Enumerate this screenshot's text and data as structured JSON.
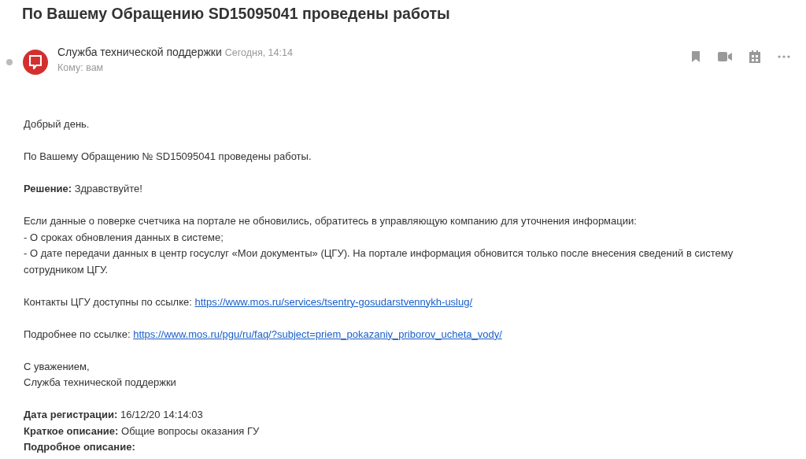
{
  "subject": "По Вашему Обращению SD15095041 проведены работы",
  "message": {
    "unread": true,
    "sender": "Служба технической поддержки",
    "date": "Сегодня, 14:14",
    "recipient": "Кому: вам"
  },
  "body": [
    {
      "lines": [
        {
          "text": "Добрый день."
        }
      ]
    },
    {
      "lines": [
        {
          "text": "По Вашему Обращению № SD15095041 проведены работы."
        }
      ]
    },
    {
      "lines": [
        {
          "text": "**Решение:** Здравствуйте!"
        }
      ]
    },
    {
      "lines": [
        {
          "text": "Если данные о поверке счетчика на портале не обновились, обратитесь в управляющую компанию для уточнения информации:"
        },
        {
          "text": "- О сроках обновления данных в системе;"
        },
        {
          "text": "- О дате передачи данных в центр госуслуг «Мои документы» (ЦГУ). На портале информация обновится только после внесения сведений в систему сотрудником ЦГУ."
        }
      ]
    },
    {
      "lines": [
        {
          "text": "Контакты ЦГУ доступны по ссылке:",
          "link": "https://www.mos.ru/services/tsentry-gosudarstvennykh-uslug/"
        }
      ]
    },
    {
      "lines": [
        {
          "text": "Подробнее по ссылке:",
          "link": "https://www.mos.ru/pgu/ru/faq/?subject=priem_pokazaniy_priborov_ucheta_vody/"
        }
      ]
    },
    {
      "lines": [
        {
          "text": "С уважением,"
        },
        {
          "text": "Служба технической поддержки"
        }
      ]
    },
    {
      "lines": [
        {
          "text": "**Дата регистрации:** 16/12/20 14:14:03"
        },
        {
          "text": "**Краткое описание:** Общие вопросы оказания ГУ"
        },
        {
          "text": "**Подробное описание:**"
        }
      ]
    }
  ]
}
